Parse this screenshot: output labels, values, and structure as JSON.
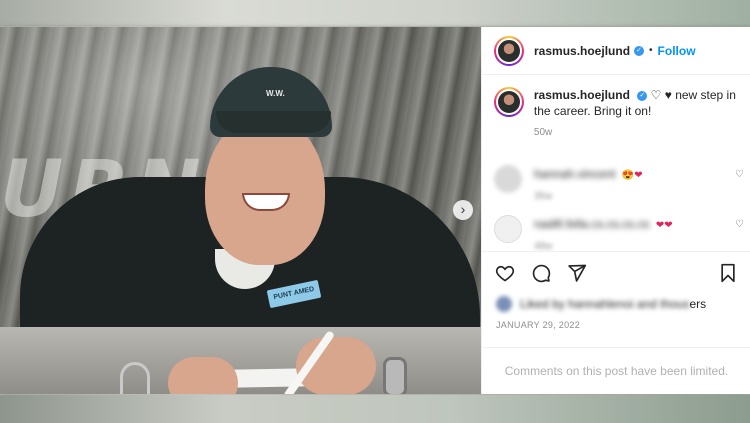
{
  "post": {
    "username": "rasmus.hoejlund",
    "follow_label": "Follow",
    "separator": "•",
    "caption_text": "new step in the career. Bring it on!",
    "caption_time": "50w",
    "date": "JANUARY 29, 2022",
    "likes_tail": "ers",
    "limited_notice": "Comments on this post have been limited."
  },
  "photo": {
    "cap_logo": "W.W.",
    "badge_text": "PUNT AMED"
  },
  "comments": [
    {
      "text": "hannah.vincent",
      "time": "35w"
    },
    {
      "text": "nadifi.fella.cs.cs.cs.cs",
      "time": "48w"
    }
  ],
  "icons": {
    "verified": "verified-badge",
    "like": "heart-outline-icon",
    "comment": "comment-icon",
    "share": "send-icon",
    "save": "bookmark-icon",
    "next": "chevron-right-icon"
  },
  "colors": {
    "follow": "#0095f6",
    "verified": "#3897f0",
    "text": "#262626",
    "muted": "#8e8e8e"
  }
}
